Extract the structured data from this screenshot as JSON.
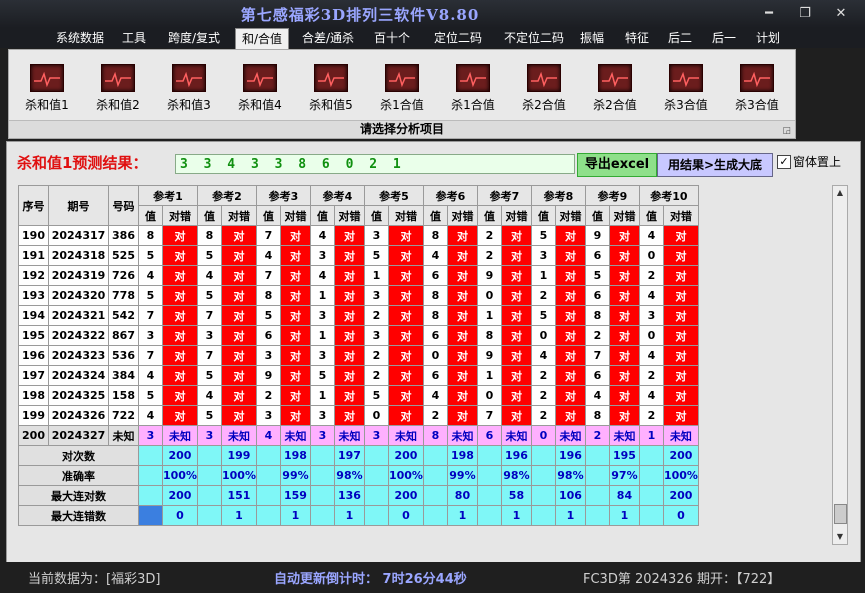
{
  "window": {
    "title": "第七感福彩3D排列三软件V8.80",
    "min": "━",
    "restore": "❐",
    "close": "✕"
  },
  "menu": [
    "系统数据",
    "工具",
    "跨度/复式",
    "和/合值",
    "合差/通杀",
    "百十个",
    "定位二码",
    "不定位二码",
    "振幅",
    "特征",
    "后二",
    "后一",
    "计划"
  ],
  "active_menu": 3,
  "ribbon": {
    "tools": [
      "杀和值1",
      "杀和值2",
      "杀和值3",
      "杀和值4",
      "杀和值5",
      "杀1合值",
      "杀1合值",
      "杀2合值",
      "杀2合值",
      "杀3合值",
      "杀3合值"
    ],
    "footer": "请选择分析项目",
    "corner": "◲"
  },
  "prediction": {
    "label": "杀和值1预测结果：",
    "value": "3 3 4 3 3 8 6 0 2 1",
    "export_label": "导出excel",
    "build_label": "用结果>生成大底",
    "pin_label": "窗体置上",
    "pin_checked": "✓"
  },
  "table": {
    "col_headers": [
      "序号",
      "期号",
      "号码"
    ],
    "group_headers": [
      "参考1",
      "参考2",
      "参考3",
      "参考4",
      "参考5",
      "参考6",
      "参考7",
      "参考8",
      "参考9",
      "参考10"
    ],
    "sub_headers": [
      "值",
      "对错"
    ],
    "rows": [
      {
        "no": "190",
        "issue": "2024317",
        "num": "386",
        "vals": [
          "8",
          "8",
          "7",
          "4",
          "3",
          "8",
          "2",
          "5",
          "9",
          "4"
        ]
      },
      {
        "no": "191",
        "issue": "2024318",
        "num": "525",
        "vals": [
          "5",
          "5",
          "4",
          "3",
          "5",
          "4",
          "2",
          "3",
          "6",
          "0"
        ]
      },
      {
        "no": "192",
        "issue": "2024319",
        "num": "726",
        "vals": [
          "4",
          "4",
          "7",
          "4",
          "1",
          "6",
          "9",
          "1",
          "5",
          "2"
        ]
      },
      {
        "no": "193",
        "issue": "2024320",
        "num": "778",
        "vals": [
          "5",
          "5",
          "8",
          "1",
          "3",
          "8",
          "0",
          "2",
          "6",
          "4"
        ]
      },
      {
        "no": "194",
        "issue": "2024321",
        "num": "542",
        "vals": [
          "7",
          "7",
          "5",
          "3",
          "2",
          "8",
          "1",
          "5",
          "8",
          "3"
        ]
      },
      {
        "no": "195",
        "issue": "2024322",
        "num": "867",
        "vals": [
          "3",
          "3",
          "6",
          "1",
          "3",
          "6",
          "8",
          "0",
          "2",
          "0"
        ]
      },
      {
        "no": "196",
        "issue": "2024323",
        "num": "536",
        "vals": [
          "7",
          "7",
          "3",
          "3",
          "2",
          "0",
          "9",
          "4",
          "7",
          "4"
        ]
      },
      {
        "no": "197",
        "issue": "2024324",
        "num": "384",
        "vals": [
          "4",
          "5",
          "9",
          "5",
          "2",
          "6",
          "1",
          "2",
          "6",
          "2"
        ]
      },
      {
        "no": "198",
        "issue": "2024325",
        "num": "158",
        "vals": [
          "5",
          "4",
          "2",
          "1",
          "5",
          "4",
          "0",
          "2",
          "4",
          "4"
        ]
      },
      {
        "no": "199",
        "issue": "2024326",
        "num": "722",
        "vals": [
          "4",
          "5",
          "3",
          "3",
          "0",
          "2",
          "7",
          "2",
          "8",
          "2"
        ]
      }
    ],
    "right_label": "对",
    "unknown_row": {
      "no": "200",
      "issue": "2024327",
      "num": "未知",
      "vals": [
        "3",
        "3",
        "4",
        "3",
        "3",
        "8",
        "6",
        "0",
        "2",
        "1"
      ],
      "mark": "未知"
    },
    "stats": [
      {
        "label": "对次数",
        "vals": [
          "200",
          "199",
          "198",
          "197",
          "200",
          "198",
          "196",
          "196",
          "195",
          "200"
        ]
      },
      {
        "label": "准确率",
        "vals": [
          "100%",
          "100%",
          "99%",
          "98%",
          "100%",
          "99%",
          "98%",
          "98%",
          "97%",
          "100%"
        ]
      },
      {
        "label": "最大连对数",
        "vals": [
          "200",
          "151",
          "159",
          "136",
          "200",
          "80",
          "58",
          "106",
          "84",
          "200"
        ]
      },
      {
        "label": "最大连错数",
        "vals": [
          "0",
          "1",
          "1",
          "1",
          "0",
          "1",
          "1",
          "1",
          "1",
          "0"
        ]
      }
    ]
  },
  "scroll": {
    "up": "▲",
    "down": "▼"
  },
  "status": {
    "data_source": "当前数据为：[福彩3D]",
    "countdown": "自动更新倒计时：  7时26分44秒",
    "issue_info": "FC3D第 2024326 期开：【722】"
  },
  "colors": {
    "accent_red": "#ff0000",
    "title_blue": "#9aa6ff",
    "cyan": "#7ff7f7",
    "pink": "#ffb0ff"
  }
}
